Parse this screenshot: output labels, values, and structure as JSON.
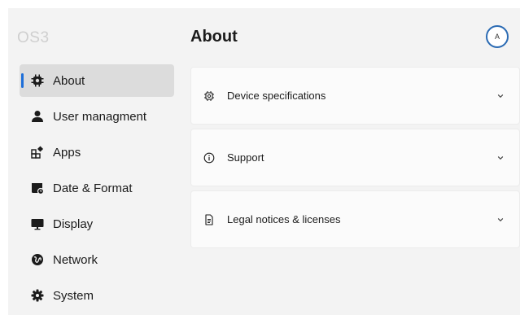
{
  "app": {
    "brand": "OS3"
  },
  "sidebar": {
    "items": [
      {
        "label": "About",
        "icon": "chip-icon",
        "active": true
      },
      {
        "label": "User managment",
        "icon": "user-icon",
        "active": false
      },
      {
        "label": "Apps",
        "icon": "apps-icon",
        "active": false
      },
      {
        "label": "Date & Format",
        "icon": "calendar-icon",
        "active": false
      },
      {
        "label": "Display",
        "icon": "monitor-icon",
        "active": false
      },
      {
        "label": "Network",
        "icon": "globe-icon",
        "active": false
      },
      {
        "label": "System",
        "icon": "gear-icon",
        "active": false
      }
    ]
  },
  "main": {
    "title": "About",
    "avatar_initial": "A",
    "sections": [
      {
        "label": "Device specifications",
        "icon": "chip-outline-icon"
      },
      {
        "label": "Support",
        "icon": "info-icon"
      },
      {
        "label": "Legal notices & licenses",
        "icon": "document-icon"
      }
    ]
  },
  "colors": {
    "accent": "#1e6fd9",
    "avatar_ring": "#2a6ab3",
    "window_bg": "#f3f3f3",
    "card_bg": "#fbfbfb",
    "active_item_bg": "#dcdcdc"
  }
}
